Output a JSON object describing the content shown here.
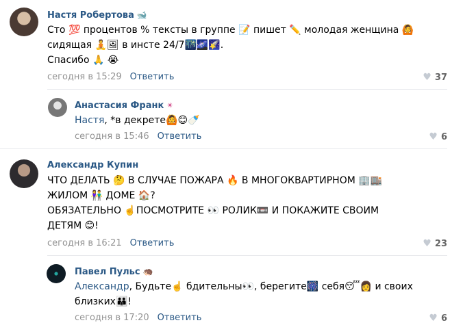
{
  "comments": [
    {
      "author": "Настя Робертова",
      "badge": "🐋",
      "lines": [
        "Сто 💯 процентов % тексты в группе 📝 пишет ✏️ молодая женщина 🙆",
        "сидящая 🧘🖼 в инсте 24/7🌃🌌🌠.",
        "Спасибо 🙏 😭"
      ],
      "time": "сегодня в 15:29",
      "reply_label": "Ответить",
      "likes": "37"
    },
    {
      "author": "Анастасия Франк",
      "badge": "✴",
      "mention": "Настя",
      "text_rest": ", *в декрете🙆😊🍼",
      "time": "сегодня в 15:46",
      "reply_label": "Ответить",
      "likes": "6"
    },
    {
      "author": "Александр Купин",
      "badge": "",
      "lines": [
        "ЧТО ДЕЛАТЬ 🤔 В СЛУЧАЕ ПОЖАРА 🔥 В МНОГОКВАРТИРНОМ 🏢🏬",
        "ЖИЛОМ 👫 ДОМЕ 🏠?",
        "ОБЯЗАТЕЛЬНО ☝️ПОСМОТРИТЕ 👀 РОЛИК📼 И ПОКАЖИТЕ СВОИМ",
        "ДЕТЯМ 😊!"
      ],
      "time": "сегодня в 16:21",
      "reply_label": "Ответить",
      "likes": "23"
    },
    {
      "author": "Павел Пульс",
      "badge": "🦔",
      "mention": "Александр",
      "text_rest_1": ", Будьте☝️ бдительны👀, берегите🎆 себя😴👩 и своих",
      "text_rest_2": "близких👪!",
      "time": "сегодня в 17:20",
      "reply_label": "Ответить",
      "likes": "6"
    }
  ]
}
